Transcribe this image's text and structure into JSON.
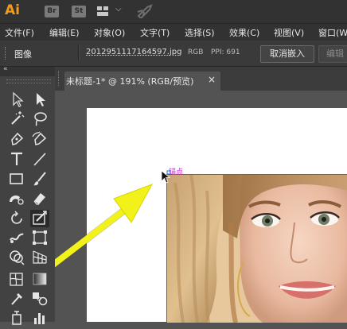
{
  "app": {
    "logo": "Ai",
    "bridge_label": "Br",
    "stock_label": "St"
  },
  "menu": {
    "items": [
      "文件(F)",
      "编辑(E)",
      "对象(O)",
      "文字(T)",
      "选择(S)",
      "效果(C)",
      "视图(V)",
      "窗口(W)"
    ]
  },
  "control": {
    "object_type": "图像",
    "file_name": "2012951117164597.jpg",
    "color_mode": "RGB",
    "ppi": "PPI: 691",
    "unembed_button": "取消嵌入",
    "edit_button": "编辑"
  },
  "document": {
    "tab_title": "未标题-1* @ 191% (RGB/预览)",
    "close_glyph": "×"
  },
  "canvas": {
    "anchor_label": "锚点"
  },
  "colors": {
    "ui_dark": "#323232",
    "ai_orange": "#f59a1b",
    "selection_blue": "#2e6bd1",
    "anchor_magenta": "#d02bd0",
    "annotation_arrow": "#f2f21a"
  },
  "tools": [
    "selection-tool",
    "direct-selection-tool",
    "magic-wand-tool",
    "lasso-tool",
    "pen-tool",
    "curvature-tool",
    "type-tool",
    "line-segment-tool",
    "rectangle-tool",
    "paintbrush-tool",
    "shaper-tool",
    "eraser-tool",
    "rotate-tool",
    "width-tool",
    "puppet-warp-tool",
    "free-transform-tool",
    "shape-builder-tool",
    "perspective-grid-tool",
    "mesh-tool",
    "gradient-tool",
    "eyedropper-tool",
    "blend-tool",
    "symbol-sprayer-tool",
    "column-graph-tool"
  ]
}
